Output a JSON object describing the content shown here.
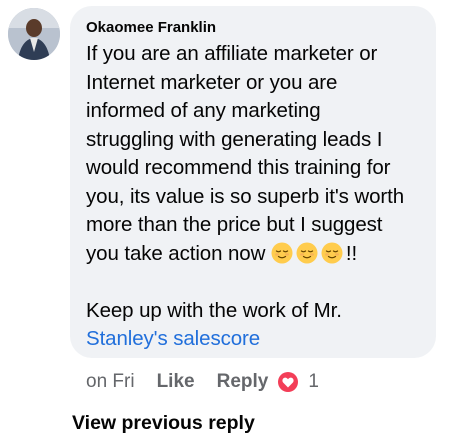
{
  "comment": {
    "author": "Okaomee Franklin",
    "lines": [
      "If you are an affiliate marketer or",
      "Internet marketer or you are",
      "informed of any marketing",
      "struggling with generating leads I",
      "would recommend this training for",
      "you, its value is so superb it's worth",
      "more than the price but I suggest"
    ],
    "last_line_text": "you take action now",
    "emoji_name": "relieved-face-emoji",
    "emoji_count": 3,
    "last_line_suffix": "!!",
    "second_paragraph": "Keep up with the work of Mr.",
    "mention": "Stanley's salescore"
  },
  "actions": {
    "time": "on Fri",
    "like_label": "Like",
    "reply_label": "Reply",
    "reaction_icon": "heart-icon",
    "reaction_count": "1"
  },
  "view_previous_reply": "View previous reply",
  "colors": {
    "bubble_bg": "#f0f2f5",
    "mention": "#216fdb",
    "secondary_text": "#65676b",
    "heart_reaction": "#f33e58"
  }
}
